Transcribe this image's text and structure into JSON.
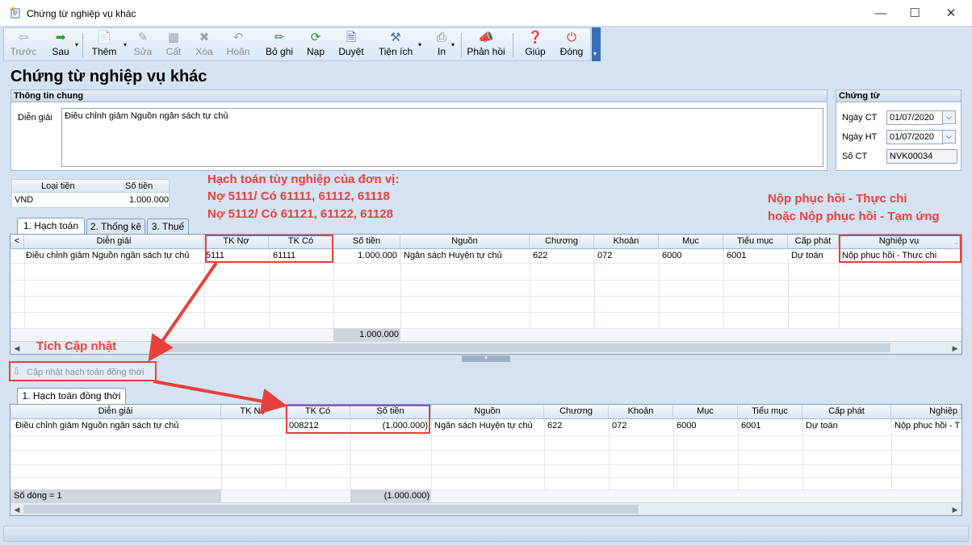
{
  "window": {
    "title": "Chứng từ nghiệp vụ khác"
  },
  "toolbar": {
    "buttons": [
      {
        "label": "Trước",
        "icon": "back-arrow-icon",
        "disabled": true
      },
      {
        "label": "Sau",
        "icon": "forward-arrow-icon",
        "disabled": false
      },
      {
        "label": "Thêm",
        "icon": "add-document-icon",
        "disabled": false
      },
      {
        "label": "Sửa",
        "icon": "edit-document-icon",
        "disabled": true
      },
      {
        "label": "Cất",
        "icon": "save-disk-icon",
        "disabled": true
      },
      {
        "label": "Xóa",
        "icon": "delete-icon",
        "disabled": true
      },
      {
        "label": "Hoãn",
        "icon": "undo-icon",
        "disabled": true
      },
      {
        "label": "Bỏ ghi",
        "icon": "unpost-pen-icon",
        "disabled": false
      },
      {
        "label": "Nạp",
        "icon": "reload-icon",
        "disabled": false
      },
      {
        "label": "Duyệt",
        "icon": "browse-icon",
        "disabled": false
      },
      {
        "label": "Tiện ích",
        "icon": "tools-icon",
        "disabled": false
      },
      {
        "label": "In",
        "icon": "printer-icon",
        "disabled": false
      },
      {
        "label": "Phản hồi",
        "icon": "megaphone-icon",
        "disabled": false
      },
      {
        "label": "Giúp",
        "icon": "help-icon",
        "disabled": false
      },
      {
        "label": "Đóng",
        "icon": "close-power-icon",
        "disabled": false
      }
    ]
  },
  "page": {
    "heading": "Chứng từ nghiệp vụ khác"
  },
  "general_info": {
    "title": "Thông tin chung",
    "description_label": "Diễn giải",
    "description_value": "Điều chỉnh giảm Nguồn ngân sách tự chủ"
  },
  "voucher": {
    "title": "Chứng từ",
    "date_ct_label": "Ngày CT",
    "date_ct_value": "01/07/2020",
    "date_ht_label": "Ngày HT",
    "date_ht_value": "01/07/2020",
    "number_label": "Số CT",
    "number_value": "NVK00034"
  },
  "currency": {
    "headers": [
      "Loại tiền",
      "Số tiền"
    ],
    "row": [
      "VND",
      "1.000.000"
    ]
  },
  "annotations": {
    "main1": "Hạch toán tùy nghiệp của đơn vị:",
    "main2": "Nợ 5111/ Có 61111, 61112, 61118",
    "main3": "Nợ 5112/ Có 61121, 61122, 61128",
    "right1": "Nộp phục hồi - Thực chi",
    "right2": "hoặc Nộp phục hồi - Tạm ứng",
    "tick": "Tích Cập nhật"
  },
  "tabs": [
    {
      "label": "1. Hạch toán"
    },
    {
      "label": "2. Thống kê"
    },
    {
      "label": "3. Thuế"
    }
  ],
  "grid1": {
    "headers": [
      "Diễn giải",
      "TK Nợ",
      "TK Có",
      "Số tiền",
      "Nguồn",
      "Chương",
      "Khoản",
      "Mục",
      "Tiểu mục",
      "Cấp phát",
      "Nghiệp vụ"
    ],
    "row": [
      "Điều chỉnh giảm Nguồn ngân sách tự chủ",
      "5111",
      "61111",
      "1.000.000",
      "Ngân sách Huyện tự chủ",
      "622",
      "072",
      "6000",
      "6001",
      "Dự toán",
      "Nộp phục hồi - Thực chi"
    ],
    "total": "1.000.000"
  },
  "update_button": {
    "label": "Cập nhật hạch toán đồng thời"
  },
  "tabs2": [
    {
      "label": "1. Hạch toán đồng thời"
    }
  ],
  "grid2": {
    "headers": [
      "Diễn giải",
      "TK Nợ",
      "TK Có",
      "Số tiền",
      "Nguồn",
      "Chương",
      "Khoản",
      "Mục",
      "Tiểu mục",
      "Cấp phát",
      "Nghiệp"
    ],
    "row": [
      "Điều chỉnh giảm Nguồn ngân sách tự chủ",
      "",
      "008212",
      "(1.000.000)",
      "Ngân sách Huyện tự chủ",
      "622",
      "072",
      "6000",
      "6001",
      "Dự toán",
      "Nộp phục hồi - T"
    ],
    "row_count": "Số dòng = 1",
    "total": "(1.000.000)"
  }
}
